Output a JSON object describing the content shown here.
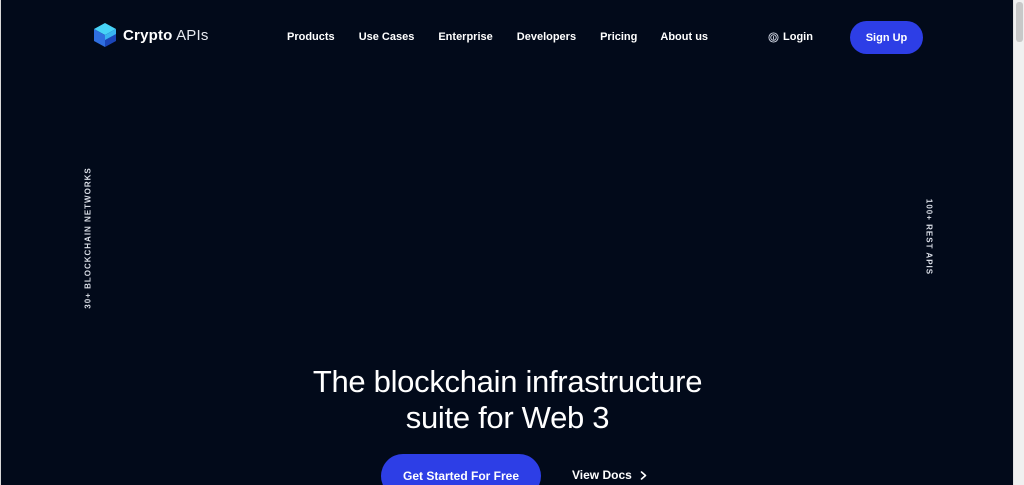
{
  "brand": {
    "name_bold": "Crypto",
    "name_light": "APIs"
  },
  "nav": {
    "items": [
      {
        "label": "Products"
      },
      {
        "label": "Use Cases"
      },
      {
        "label": "Enterprise"
      },
      {
        "label": "Developers"
      },
      {
        "label": "Pricing"
      },
      {
        "label": "About us"
      }
    ],
    "login_label": "Login",
    "signup_label": "Sign Up"
  },
  "side": {
    "left_label": "30+ BLOCKCHAIN NETWORKS",
    "right_label": "100+ REST APIS"
  },
  "hero": {
    "title_line1": "The blockchain infrastructure",
    "title_line2": "suite for Web 3",
    "primary_cta": "Get Started For Free",
    "secondary_cta": "View Docs"
  },
  "colors": {
    "background": "#020a1a",
    "accent": "#2d3ee6",
    "logo_light": "#38c6f4",
    "logo_dark": "#2f6fe0"
  },
  "icons": {
    "logo": "cube-logo-icon",
    "login": "fingerprint-icon",
    "docs": "chevron-right-icon"
  }
}
